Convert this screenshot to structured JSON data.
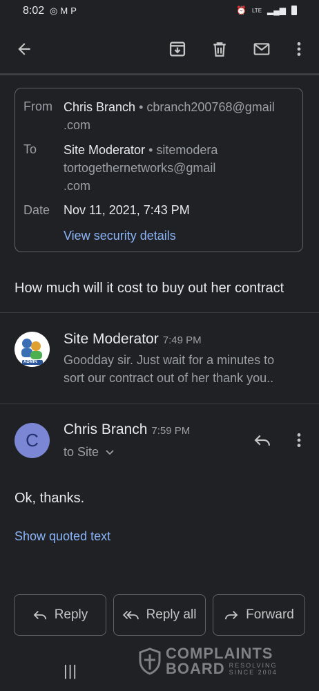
{
  "status": {
    "time": "8:02",
    "network": "LTE"
  },
  "meta": {
    "from_label": "From",
    "from_name": "Chris Branch",
    "from_email_1": "• cbranch200768@gmail",
    "from_email_2": ".com",
    "to_label": "To",
    "to_name": "Site Moderator",
    "to_email_1": "• sitemodera",
    "to_email_2": "tortogethernetworks@gmail",
    "to_email_3": ".com",
    "date_label": "Date",
    "date_value": "Nov 11, 2021, 7:43 PM",
    "security_link": "View security details"
  },
  "subject": "How much will it cost to buy out her contract",
  "messages": [
    {
      "sender": "Site Moderator",
      "time": "7:49 PM",
      "snippet_1": "Goodday sir. Just wait for a minutes to",
      "snippet_2": "sort our contract out of her thank you..",
      "avatar_label": "ADMIN"
    },
    {
      "sender": "Chris Branch",
      "time": "7:59 PM",
      "recipient": "to Site",
      "avatar_letter": "C",
      "body": "Ok, thanks.",
      "quoted_link": "Show quoted text"
    }
  ],
  "actions": {
    "reply": "Reply",
    "reply_all": "Reply all",
    "forward": "Forward"
  },
  "watermark": {
    "line1": "COMPLAINTS",
    "line2": "BOARD",
    "line3": "RESOLVING",
    "line4": "SINCE 2004"
  },
  "colors": {
    "background": "#202124",
    "link": "#8ab4f8",
    "avatar_c": "#7b86d4"
  }
}
